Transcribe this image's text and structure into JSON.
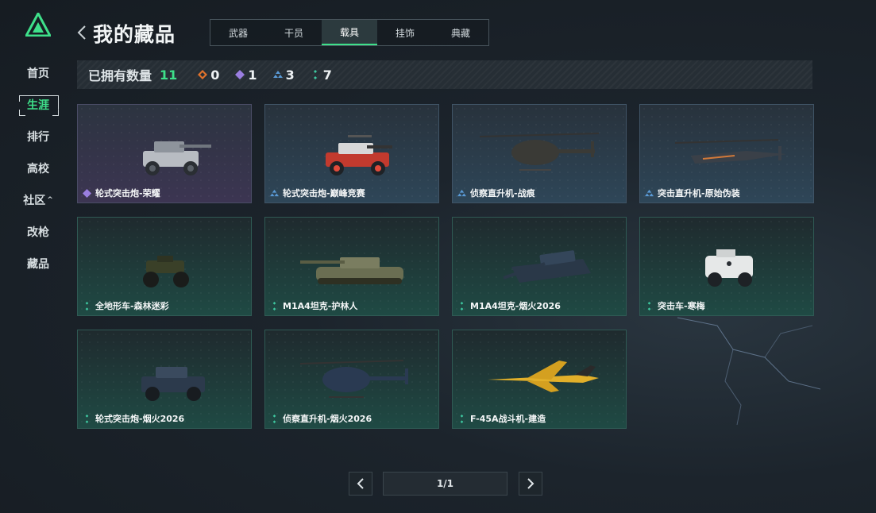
{
  "nav": {
    "items": [
      {
        "label": "首页",
        "active": false
      },
      {
        "label": "生涯",
        "active": true
      },
      {
        "label": "排行",
        "active": false
      },
      {
        "label": "高校",
        "active": false
      },
      {
        "label": "社区",
        "active": false,
        "caret": "^"
      },
      {
        "label": "改枪",
        "active": false
      },
      {
        "label": "藏品",
        "active": false
      }
    ]
  },
  "header": {
    "title": "我的藏品",
    "tabs": [
      "武器",
      "干员",
      "载具",
      "挂饰",
      "典藏"
    ],
    "active_tab": "载具"
  },
  "stats": {
    "label": "已拥有数量",
    "total": "11",
    "counts": [
      {
        "rarity": "orange",
        "value": "0"
      },
      {
        "rarity": "purple",
        "value": "1"
      },
      {
        "rarity": "blue",
        "value": "3"
      },
      {
        "rarity": "green",
        "value": "7"
      }
    ]
  },
  "items": [
    {
      "name": "轮式突击炮-荣耀",
      "rarity": "purple",
      "icon": "wheeled-assault-gun-icon"
    },
    {
      "name": "轮式突击炮-巅峰竞赛",
      "rarity": "blue",
      "icon": "wheeled-assault-gun-icon"
    },
    {
      "name": "侦察直升机-战痕",
      "rarity": "blue",
      "icon": "scout-helicopter-icon"
    },
    {
      "name": "突击直升机-原始伪装",
      "rarity": "blue",
      "icon": "attack-helicopter-icon"
    },
    {
      "name": "全地形车-森林迷彩",
      "rarity": "green",
      "icon": "atv-icon"
    },
    {
      "name": "M1A4坦克-护林人",
      "rarity": "green",
      "icon": "tank-icon"
    },
    {
      "name": "M1A4坦克-烟火2026",
      "rarity": "green",
      "icon": "tank-icon"
    },
    {
      "name": "突击车-寒梅",
      "rarity": "green",
      "icon": "assault-vehicle-icon"
    },
    {
      "name": "轮式突击炮-烟火2026",
      "rarity": "green",
      "icon": "wheeled-assault-gun-icon"
    },
    {
      "name": "侦察直升机-烟火2026",
      "rarity": "green",
      "icon": "scout-helicopter-icon"
    },
    {
      "name": "F-45A战斗机-建造",
      "rarity": "green",
      "icon": "fighter-jet-icon"
    }
  ],
  "pagination": {
    "indicator": "1/1"
  },
  "colors": {
    "accent": "#3ee08a",
    "orange": "#e0722c",
    "purple": "#9a7ee0",
    "blue": "#5a9ad6",
    "green": "#3ec8a0"
  }
}
